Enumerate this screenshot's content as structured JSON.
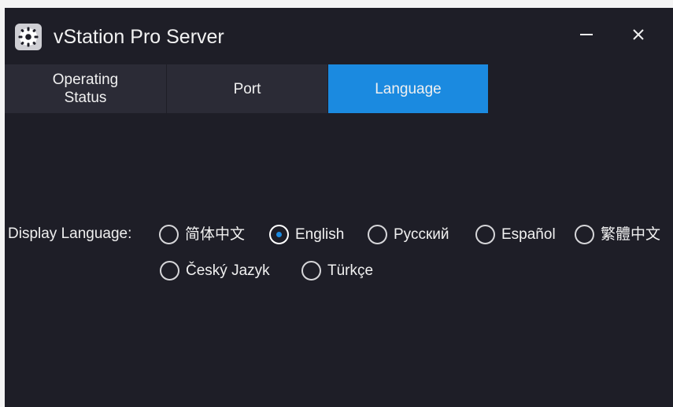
{
  "window": {
    "title": "vStation Pro Server",
    "icons": {
      "app": "gear-icon",
      "minimize": "minimize-icon",
      "close": "close-icon"
    },
    "colors": {
      "background": "#1e1e27",
      "tab_inactive": "#2b2b36",
      "tab_active": "#1b8ae0"
    }
  },
  "tabs": [
    {
      "label": "Operating Status",
      "active": false
    },
    {
      "label": "Port",
      "active": false
    },
    {
      "label": "Language",
      "active": true
    }
  ],
  "language": {
    "label": "Display Language:",
    "selected": "English",
    "options": [
      {
        "label": "简体中文"
      },
      {
        "label": "English"
      },
      {
        "label": "Русский"
      },
      {
        "label": "Español"
      },
      {
        "label": "繁體中文"
      },
      {
        "label": "Český Jazyk"
      },
      {
        "label": "Türkçe"
      }
    ]
  }
}
